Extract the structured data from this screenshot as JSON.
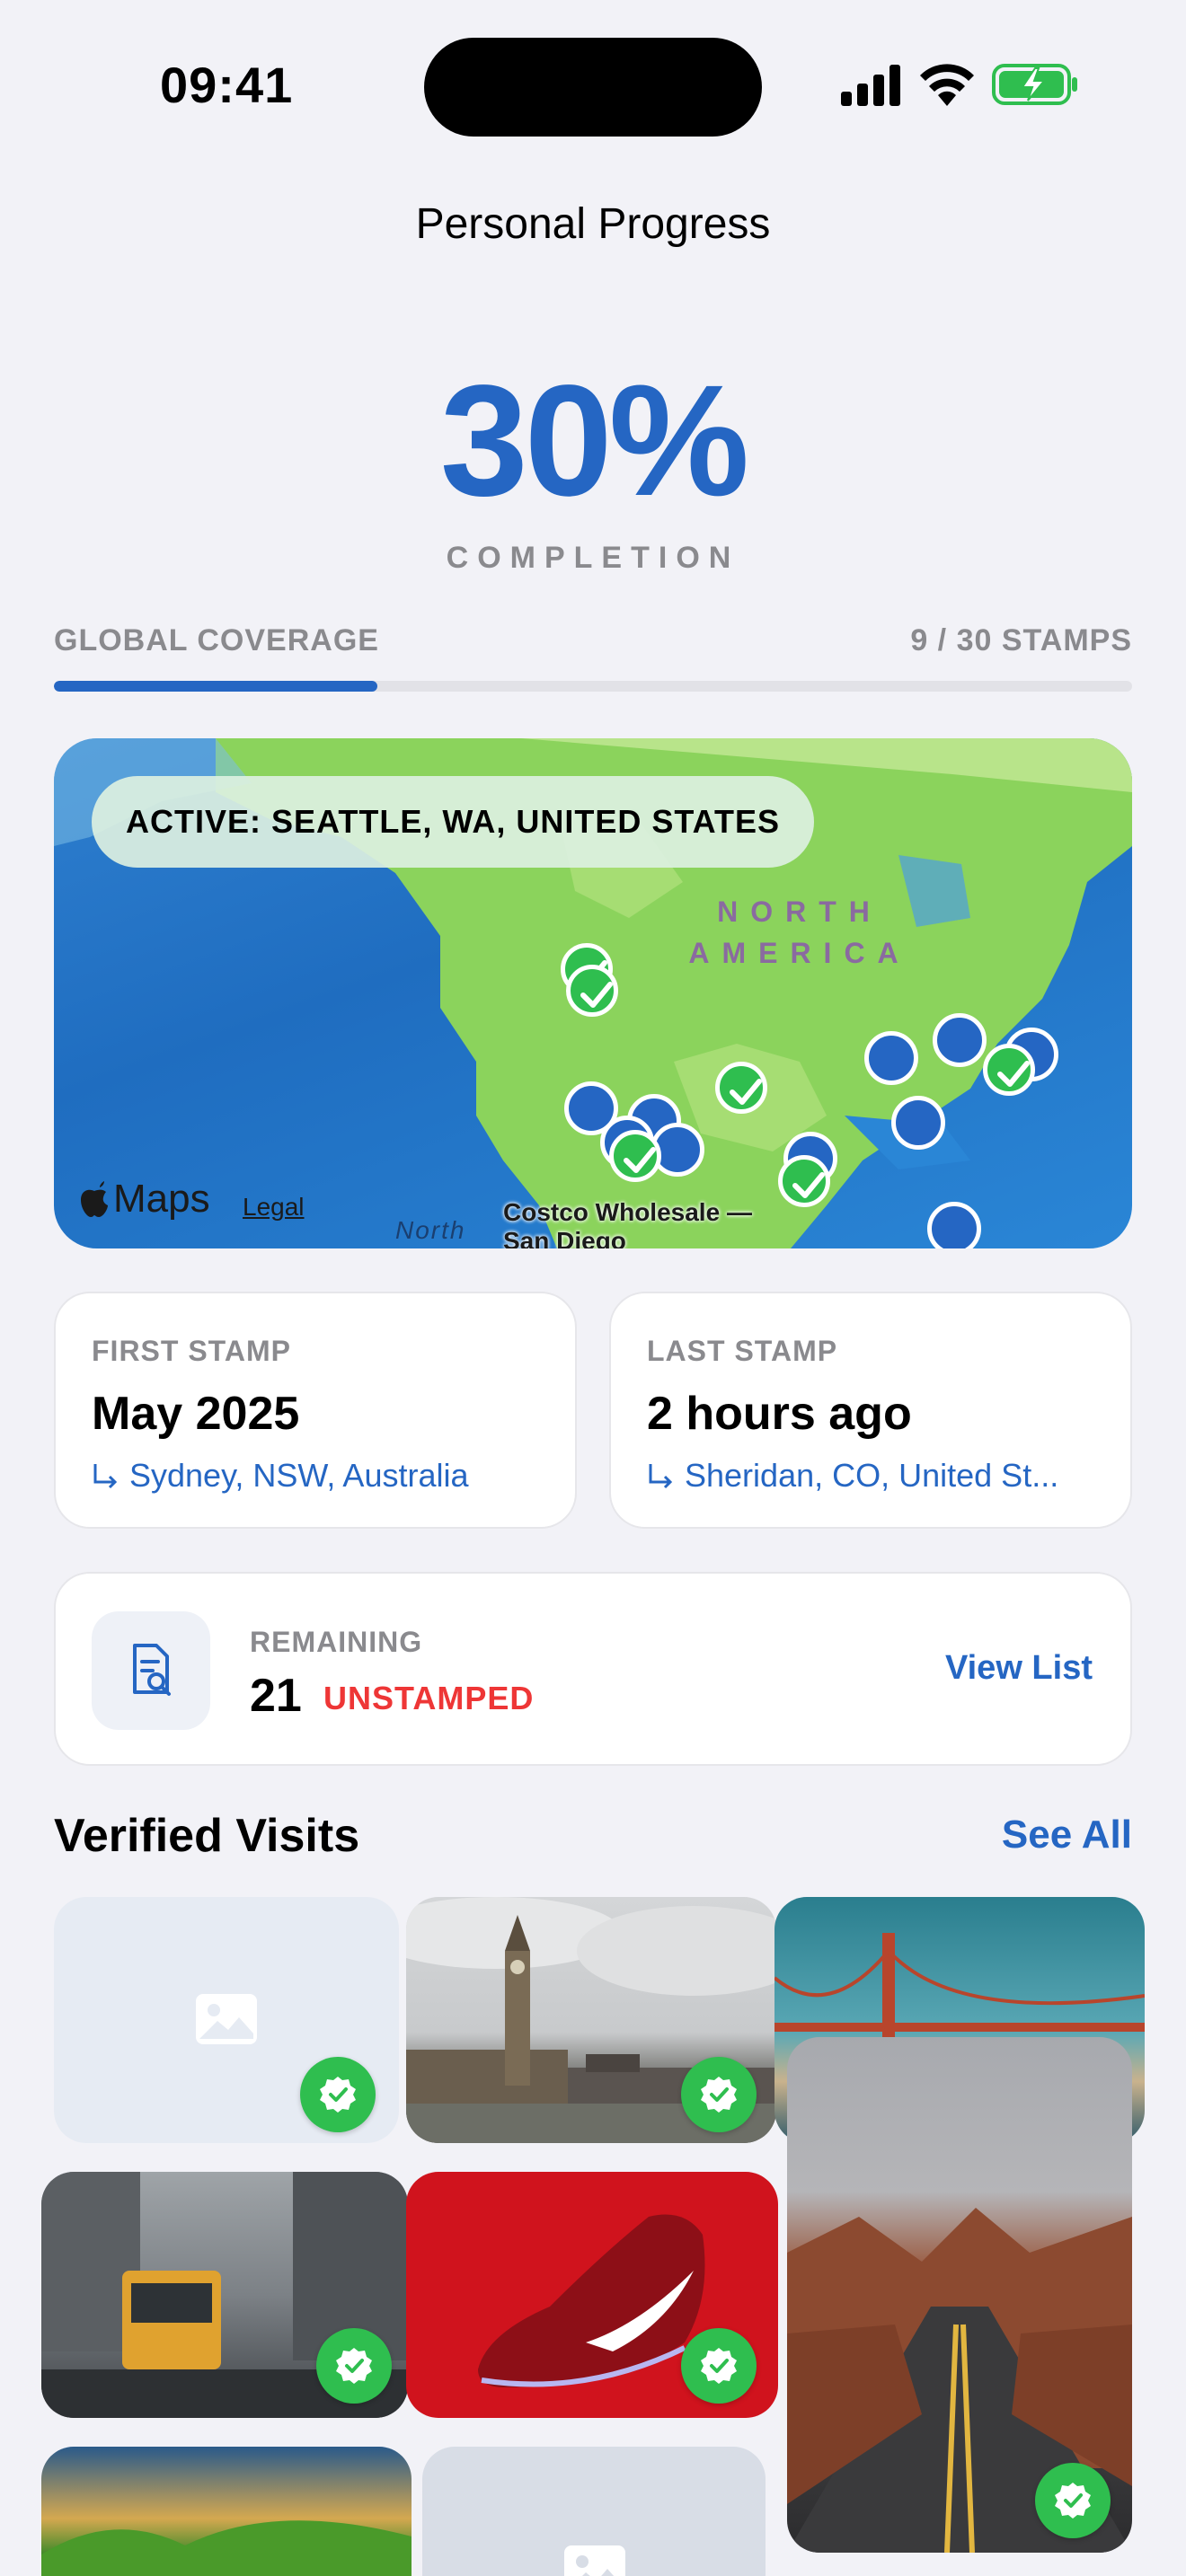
{
  "status_bar": {
    "time": "09:41"
  },
  "header": {
    "title": "Personal Progress"
  },
  "summary": {
    "percent": "30%",
    "percent_label": "COMPLETION",
    "coverage_label": "GLOBAL COVERAGE",
    "coverage_count": "9 / 30 STAMPS",
    "progress_fraction": 0.3
  },
  "map": {
    "active_location": "ACTIVE: SEATTLE, WA, UNITED STATES",
    "region_label": "NORTH AMERICA",
    "maps_brand": "Maps",
    "legal": "Legal",
    "poi": "Costco Wholesale — San Diego",
    "partial_label": "North"
  },
  "first_stamp": {
    "label": "FIRST STAMP",
    "value": "May 2025",
    "location": "Sydney, NSW, Australia"
  },
  "last_stamp": {
    "label": "LAST STAMP",
    "value": "2 hours ago",
    "location": "Sheridan, CO, United St..."
  },
  "remaining": {
    "label": "REMAINING",
    "count": "21",
    "status": "UNSTAMPED",
    "action": "View List"
  },
  "verified_visits": {
    "title": "Verified Visits",
    "action": "See All",
    "photos": [
      {
        "name": "placeholder",
        "verified": true
      },
      {
        "name": "big-ben-london",
        "verified": true
      },
      {
        "name": "golden-gate-bridge",
        "verified": false
      },
      {
        "name": "snowy-city-bus",
        "verified": true
      },
      {
        "name": "red-sneaker",
        "verified": true
      },
      {
        "name": "desert-road",
        "verified": true
      },
      {
        "name": "green-hills-sunset",
        "verified": false
      },
      {
        "name": "placeholder",
        "verified": false
      }
    ]
  },
  "colors": {
    "accent": "#2566c3",
    "danger": "#ee3636",
    "success": "#2fbe4f",
    "background": "#f2f2f7"
  }
}
